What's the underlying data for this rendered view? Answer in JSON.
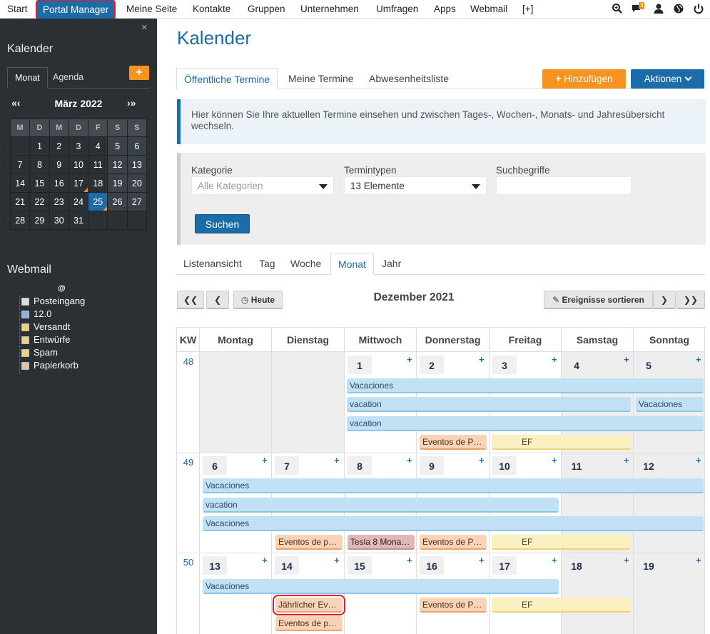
{
  "topnav": {
    "items": [
      "Start",
      "Portal Manager",
      "Meine Seite",
      "Kontakte",
      "Gruppen",
      "Unternehmen",
      "Umfragen",
      "Apps",
      "Webmail",
      "[+]"
    ],
    "badge": "3",
    "icons": [
      "search-icon",
      "chat-icon",
      "user-icon",
      "globe-icon",
      "power-icon"
    ]
  },
  "sidebar": {
    "close": "×",
    "calendar_heading": "Kalender",
    "tabs": [
      "Monat",
      "Agenda"
    ],
    "add": "+",
    "prev": "«‹",
    "next": "›»",
    "month": "März 2022",
    "weekdays": [
      "M",
      "D",
      "M",
      "D",
      "F",
      "S",
      "S"
    ],
    "weeks": [
      [
        "",
        "1",
        "2",
        "3",
        "4",
        "5",
        "6"
      ],
      [
        "7",
        "8",
        "9",
        "10",
        "11",
        "12",
        "13"
      ],
      [
        "14",
        "15",
        "16",
        "17",
        "18",
        "19",
        "20"
      ],
      [
        "21",
        "22",
        "23",
        "24",
        "25",
        "26",
        "27"
      ],
      [
        "28",
        "29",
        "30",
        "31",
        "",
        "",
        ""
      ]
    ],
    "today": "25",
    "webmail_heading": "Webmail",
    "webmail_root": "@",
    "folders": [
      "Posteingang",
      "12.0",
      "Versandt",
      "Entwürfe",
      "Spam",
      "Papierkorb"
    ]
  },
  "main": {
    "title": "Kalender",
    "tabs": [
      "Öffentliche Termine",
      "Meine Termine",
      "Abwesenheitsliste"
    ],
    "add_button": "Hinzufügen",
    "actions_button": "Aktionen",
    "info": "Hier können Sie Ihre aktuellen Termine einsehen und zwischen Tages-, Wochen-, Monats- und Jahresübersicht wechseln.",
    "filter": {
      "category_label": "Kategorie",
      "category_value": "Alle Kategorien",
      "types_label": "Termintypen",
      "types_value": "13 Elemente",
      "search_label": "Suchbegriffe",
      "search_value": "",
      "search_button": "Suchen"
    },
    "view_tabs": [
      "Listenansicht",
      "Tag",
      "Woche",
      "Monat",
      "Jahr"
    ],
    "today_button": "Heute",
    "sort_button": "Ereignisse sortieren",
    "month_title": "Dezember 2021",
    "headers": [
      "KW",
      "Montag",
      "Dienstag",
      "Mittwoch",
      "Donnerstag",
      "Freitag",
      "Samstag",
      "Sonntag"
    ],
    "weeks": [
      {
        "kw": "48",
        "days": [
          "",
          "",
          "1",
          "2",
          "3",
          "4",
          "5"
        ]
      },
      {
        "kw": "49",
        "days": [
          "6",
          "7",
          "8",
          "9",
          "10",
          "11",
          "12"
        ]
      },
      {
        "kw": "50",
        "days": [
          "13",
          "14",
          "15",
          "16",
          "17",
          "18",
          "19"
        ]
      }
    ],
    "events": {
      "w48": [
        "Vacaciones",
        "vacation",
        "vacation",
        "Eventos de P…",
        "EF",
        "Vacaciones"
      ],
      "w49": [
        "Vacaciones",
        "vacation",
        "Vacaciones",
        "Eventos de p…",
        "Tesla 8 Mona…",
        "Eventos de P…",
        "EF"
      ],
      "w50": [
        "Vacaciones",
        "Jährlicher Ev…",
        "Eventos de p…",
        "Eventos de P…",
        "EF"
      ]
    },
    "colors": {
      "accent": "#1b6ca8",
      "orange": "#f7931e",
      "highlight": "#e21b2d"
    }
  }
}
